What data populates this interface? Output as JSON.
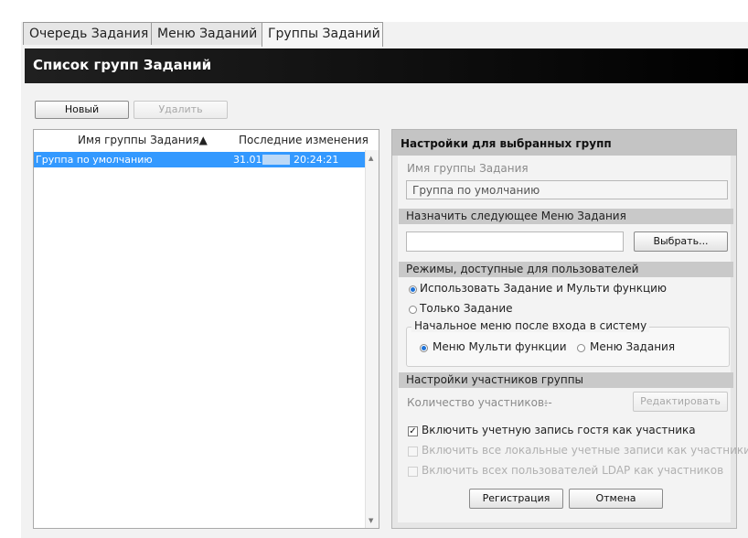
{
  "tabs": [
    {
      "label": "Очередь Задания"
    },
    {
      "label": "Меню Заданий"
    },
    {
      "label": "Группы Заданий"
    }
  ],
  "header": {
    "title": "Список групп Заданий"
  },
  "toolbar": {
    "new_label": "Новый",
    "delete_label": "Удалить"
  },
  "list": {
    "columns": [
      "Имя группы Задания▲",
      "Последние изменения"
    ],
    "rows": [
      {
        "name": "Группа по умолчанию",
        "date_prefix": "31.01.",
        "time": "20:24:21"
      }
    ]
  },
  "panel": {
    "title": "Настройки для выбранных групп",
    "group_name_label": "Имя группы Задания",
    "group_name_value": "Группа по умолчанию",
    "assign_menu_section": "Назначить следующее Меню Задания",
    "assign_menu_value": "",
    "select_button": "Выбрать...",
    "modes_section": "Режимы, доступные для пользователей",
    "mode_options": [
      "Использовать Задание и Мульти функцию",
      "Только Задание"
    ],
    "start_menu_legend": "Начальное меню после входа в систему",
    "start_menu_options": [
      "Меню Мульти функции",
      "Меню Задания"
    ],
    "members_section": "Настройки участников группы",
    "members_count_label": "Количество участников:",
    "members_count_value": "--",
    "edit_button": "Редактировать",
    "checkboxes": [
      {
        "label": "Включить учетную запись гостя как участника",
        "checked": true,
        "enabled": true
      },
      {
        "label": "Включить все локальные учетные записи как участники",
        "checked": false,
        "enabled": false
      },
      {
        "label": "Включить всех пользователей LDAP как участников",
        "checked": false,
        "enabled": false
      }
    ],
    "register_button": "Регистрация",
    "cancel_button": "Отмена"
  },
  "colors": {
    "selection": "#3399ff",
    "header_bg": "#000000",
    "accent": "#1e73d8"
  }
}
